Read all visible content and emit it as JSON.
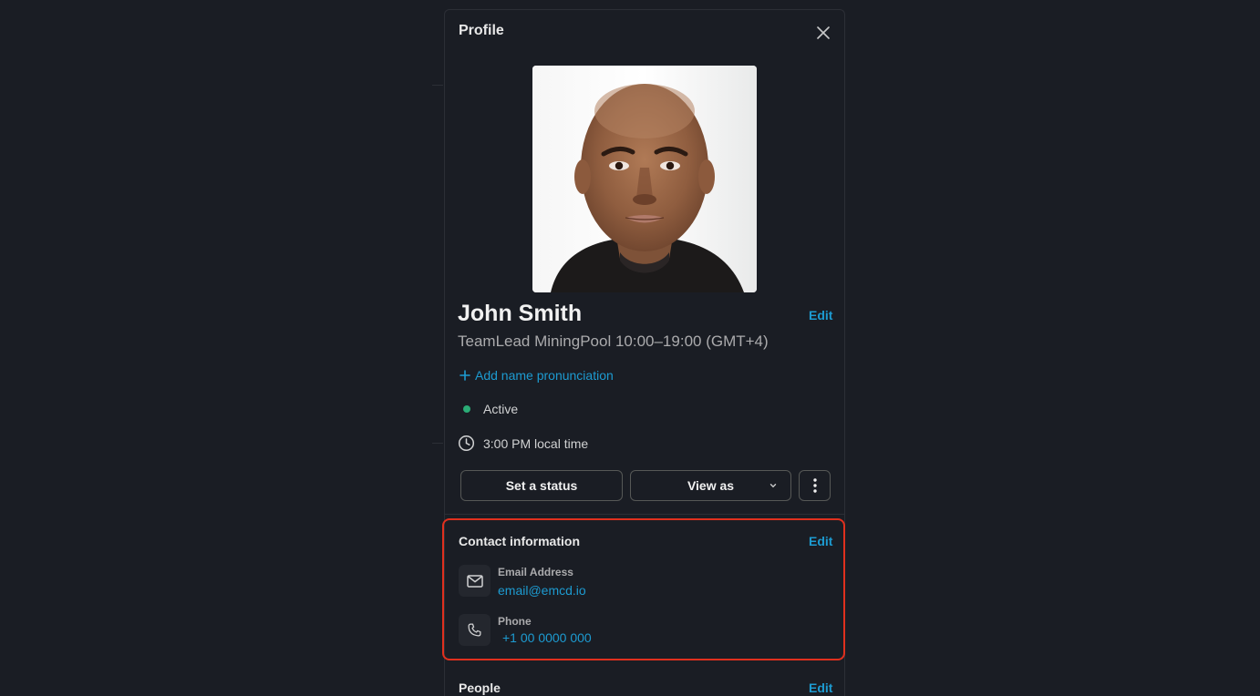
{
  "panel": {
    "title": "Profile"
  },
  "profile": {
    "name": "John Smith",
    "edit_label": "Edit",
    "subtitle": "TeamLead MiningPool 10:00–19:00 (GMT+4)",
    "add_pronunciation": "Add name pronunciation",
    "status": "Active",
    "local_time": "3:00 PM local time"
  },
  "actions": {
    "set_status": "Set a status",
    "view_as": "View as"
  },
  "contact": {
    "title": "Contact information",
    "edit_label": "Edit",
    "email_label": "Email Address",
    "email_value": "email@emcd.io",
    "phone_label": "Phone",
    "phone_value": "+1 00 0000 000"
  },
  "people": {
    "title": "People",
    "edit_label": "Edit"
  },
  "icons": {
    "close": "close-icon",
    "plus": "plus-icon",
    "clock": "clock-icon",
    "chevron": "chevron-down-icon",
    "more": "more-vertical-icon",
    "mail": "mail-icon",
    "phone": "phone-icon"
  },
  "colors": {
    "link": "#1d9bd1",
    "active": "#2bac76",
    "highlight": "#e0301e",
    "background": "#1a1d24"
  }
}
